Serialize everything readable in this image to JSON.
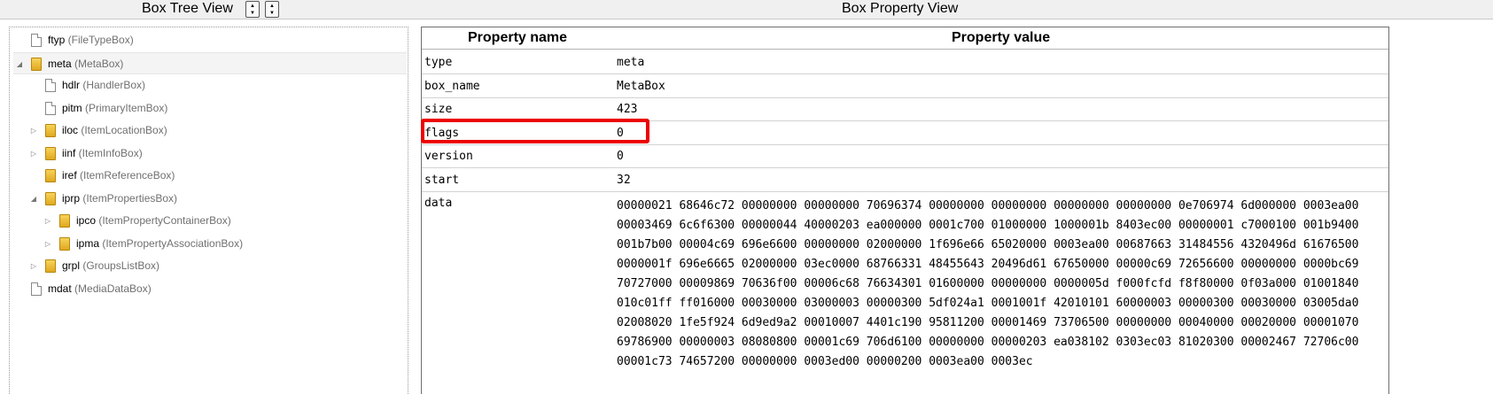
{
  "left_panel": {
    "title": "Box Tree View",
    "sort_asc_glyph": "▲",
    "sort_desc_glyph": "▼"
  },
  "right_panel": {
    "title": "Box Property View"
  },
  "tree": {
    "nodes": [
      {
        "type": "ftyp",
        "name": "(FileTypeBox)",
        "depth": 0,
        "icon": "file-icon",
        "expander": ""
      },
      {
        "type": "meta",
        "name": "(MetaBox)",
        "depth": 0,
        "icon": "folder-icon",
        "expander": "◢",
        "selected": true
      },
      {
        "type": "hdlr",
        "name": "(HandlerBox)",
        "depth": 1,
        "icon": "file-icon",
        "expander": ""
      },
      {
        "type": "pitm",
        "name": "(PrimaryItemBox)",
        "depth": 1,
        "icon": "file-icon",
        "expander": ""
      },
      {
        "type": "iloc",
        "name": "(ItemLocationBox)",
        "depth": 1,
        "icon": "folder-icon",
        "expander": "▷"
      },
      {
        "type": "iinf",
        "name": "(ItemInfoBox)",
        "depth": 1,
        "icon": "folder-icon",
        "expander": "▷"
      },
      {
        "type": "iref",
        "name": "(ItemReferenceBox)",
        "depth": 1,
        "icon": "folder-icon",
        "expander": ""
      },
      {
        "type": "iprp",
        "name": "(ItemPropertiesBox)",
        "depth": 1,
        "icon": "folder-icon",
        "expander": "◢"
      },
      {
        "type": "ipco",
        "name": "(ItemPropertyContainerBox)",
        "depth": 2,
        "icon": "folder-icon",
        "expander": "▷"
      },
      {
        "type": "ipma",
        "name": "(ItemPropertyAssociationBox)",
        "depth": 2,
        "icon": "folder-icon",
        "expander": "▷"
      },
      {
        "type": "grpl",
        "name": "(GroupsListBox)",
        "depth": 1,
        "icon": "folder-icon",
        "expander": "▷"
      },
      {
        "type": "mdat",
        "name": "(MediaDataBox)",
        "depth": 0,
        "icon": "file-icon",
        "expander": ""
      }
    ]
  },
  "properties": {
    "header_name": "Property name",
    "header_value": "Property value",
    "rows": [
      {
        "name": "type",
        "value": "meta"
      },
      {
        "name": "box_name",
        "value": "MetaBox"
      },
      {
        "name": "size",
        "value": "423"
      },
      {
        "name": "flags",
        "value": "0"
      },
      {
        "name": "version",
        "value": "0"
      },
      {
        "name": "start",
        "value": "32"
      }
    ],
    "data_label": "data",
    "data_lines": [
      "00000021 68646c72 00000000 00000000 70696374 00000000 00000000 00000000 00000000 0e706974 6d000000 0003ea00",
      "00003469 6c6f6300 00000044 40000203 ea000000 0001c700 01000000 1000001b 8403ec00 00000001 c7000100 001b9400",
      "001b7b00 00004c69 696e6600 00000000 02000000 1f696e66 65020000 0003ea00 00687663 31484556 4320496d 61676500",
      "0000001f 696e6665 02000000 03ec0000 68766331 48455643 20496d61 67650000 00000c69 72656600 00000000 0000bc69",
      "70727000 00009869 70636f00 00006c68 76634301 01600000 00000000 0000005d f000fcfd f8f80000 0f03a000 01001840",
      "010c01ff ff016000 00030000 03000003 00000300 5df024a1 0001001f 42010101 60000003 00000300 00030000 03005da0",
      "02008020 1fe5f924 6d9ed9a2 00010007 4401c190 95811200 00001469 73706500 00000000 00040000 00020000 00001070",
      "69786900 00000003 08080800 00001c69 706d6100 00000000 00000203 ea038102 0303ec03 81020300 00002467 72706c00",
      "00001c73 74657200 00000000 0003ed00 00000200 0003ea00 0003ec"
    ]
  },
  "highlight": {
    "color": "#ec0000",
    "target": "flags"
  }
}
